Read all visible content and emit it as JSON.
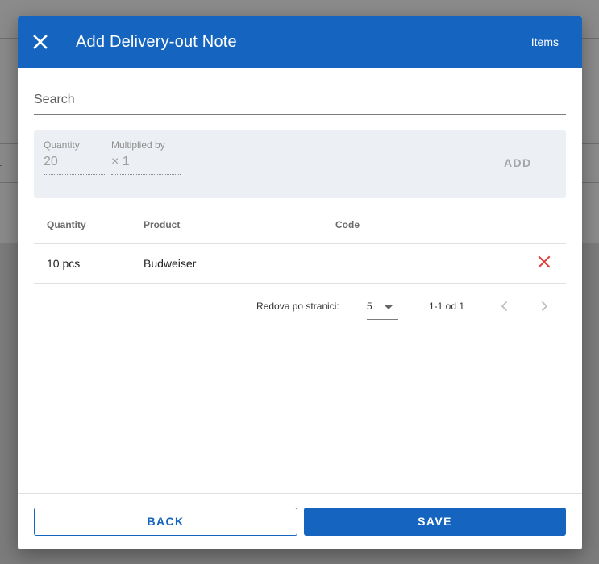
{
  "dialog": {
    "title": "Add Delivery-out Note",
    "header_action": "Items"
  },
  "search": {
    "label": "Search"
  },
  "add_panel": {
    "quantity_label": "Quantity",
    "quantity_value": "20",
    "multiplier_label": "Multiplied by",
    "multiplier_value": "× 1",
    "add_label": "ADD"
  },
  "table": {
    "columns": [
      "Quantity",
      "Product",
      "Code"
    ],
    "rows": [
      {
        "quantity": "10 pcs",
        "product": "Budweiser",
        "code": ""
      }
    ]
  },
  "pagination": {
    "rows_per_page_label": "Redova po stranici:",
    "rows_per_page_value": "5",
    "range_text": "1-1 od 1"
  },
  "footer": {
    "back_label": "BACK",
    "save_label": "SAVE"
  },
  "colors": {
    "primary": "#1565c0",
    "delete": "#e53935",
    "panel_bg": "#eceff3"
  },
  "icons": {
    "close": "close-icon",
    "delete": "close-icon",
    "prev": "chevron-left-icon",
    "next": "chevron-right-icon",
    "select": "caret-down-icon"
  }
}
